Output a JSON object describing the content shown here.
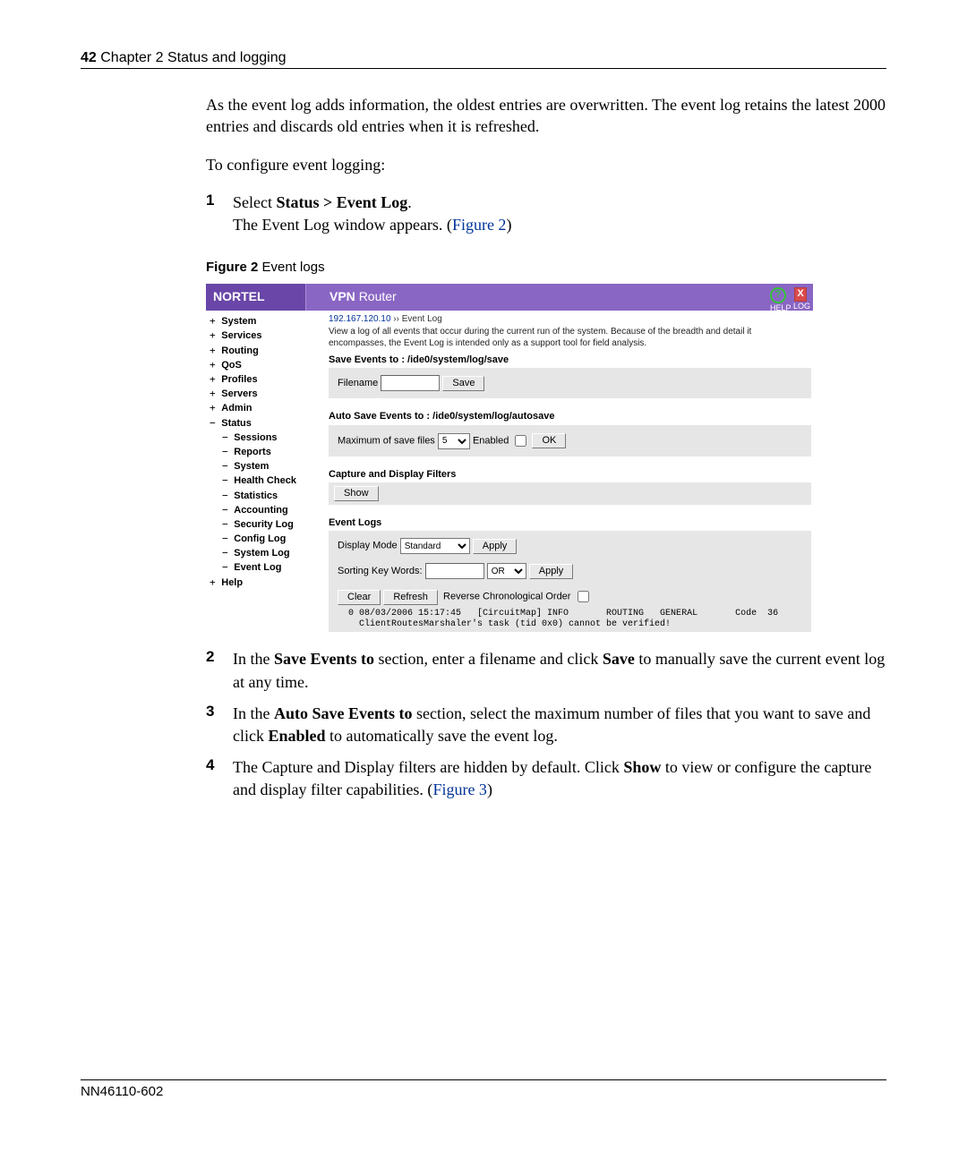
{
  "page": {
    "number": "42",
    "chapter": "Chapter 2  Status and logging",
    "footer_doc": "NN46110-602"
  },
  "text": {
    "intro": "As the event log adds information, the oldest entries are overwritten. The event log retains the latest 2000 entries and discards old entries when it is refreshed.",
    "configure_lead": "To configure event logging:",
    "step1_line1_pre": "Select ",
    "step1_bold": "Status > Event Log",
    "step1_line1_post": ".",
    "step1_line2_pre": "The Event Log window appears. (",
    "step1_xref": "Figure 2",
    "step1_line2_post": ")",
    "fig2_label": "Figure 2",
    "fig2_title": "   Event logs",
    "step2": {
      "pre": "In the ",
      "b1": "Save Events to",
      "mid1": " section, enter a filename and click ",
      "b2": "Save",
      "post": " to manually save the current event log at any time."
    },
    "step3": {
      "pre": "In the ",
      "b1": "Auto Save Events to",
      "mid1": " section, select the maximum number of files that you want to save and click ",
      "b2": "Enabled",
      "post": " to automatically save the event log."
    },
    "step4": {
      "pre": "The Capture and Display filters are hidden by default. Click ",
      "b1": "Show",
      "mid": " to view or configure the capture and display filter capabilities. (",
      "xref": "Figure 3",
      "post": ")"
    }
  },
  "shot": {
    "logo": "NORTEL",
    "title_bold": "VPN ",
    "title_thin": "Router",
    "help_label": "HELP",
    "log_label": "LOG",
    "sidebar": {
      "top": [
        {
          "label": "System",
          "cls": "plus"
        },
        {
          "label": "Services",
          "cls": "plus"
        },
        {
          "label": "Routing",
          "cls": "plus"
        },
        {
          "label": "QoS",
          "cls": "plus"
        },
        {
          "label": "Profiles",
          "cls": "plus"
        },
        {
          "label": "Servers",
          "cls": "plus"
        },
        {
          "label": "Admin",
          "cls": "plus"
        },
        {
          "label": "Status",
          "cls": "minus"
        }
      ],
      "sub": [
        "Sessions",
        "Reports",
        "System",
        "Health Check",
        "Statistics",
        "Accounting",
        "Security Log",
        "Config Log",
        "System Log",
        "Event Log"
      ],
      "bottom": [
        {
          "label": "Help",
          "cls": "plus"
        }
      ]
    },
    "breadcrumb_ip": "192.167.120.10",
    "breadcrumb_sep": " ›› ",
    "breadcrumb_page": "Event Log",
    "hint": "View a log of all events that occur during the current run of the system. Because of the breadth and detail it encompasses, the Event Log is intended only as a support tool for field analysis.",
    "save_events_label": "Save Events to : /ide0/system/log/save",
    "filename_label": "Filename",
    "save_btn": "Save",
    "autosave_label": "Auto Save Events to : /ide0/system/log/autosave",
    "max_files_label": "Maximum of save files",
    "max_files_value": "5",
    "enabled_label": "Enabled",
    "ok_btn": "OK",
    "filters_heading": "Capture and Display Filters",
    "show_btn": "Show",
    "event_logs_heading": "Event Logs",
    "display_mode_label": "Display Mode",
    "display_mode_value": "Standard",
    "apply_btn": "Apply",
    "sorting_label": "Sorting Key Words:",
    "sorting_op": "OR",
    "clear_btn": "Clear",
    "refresh_btn": "Refresh",
    "reverse_label": "Reverse Chronological Order",
    "log_lines": "  0 08/03/2006 15:17:45   [CircuitMap] INFO       ROUTING   GENERAL       Code  36\n    ClientRoutesMarshaler's task (tid 0x0) cannot be verified!"
  }
}
